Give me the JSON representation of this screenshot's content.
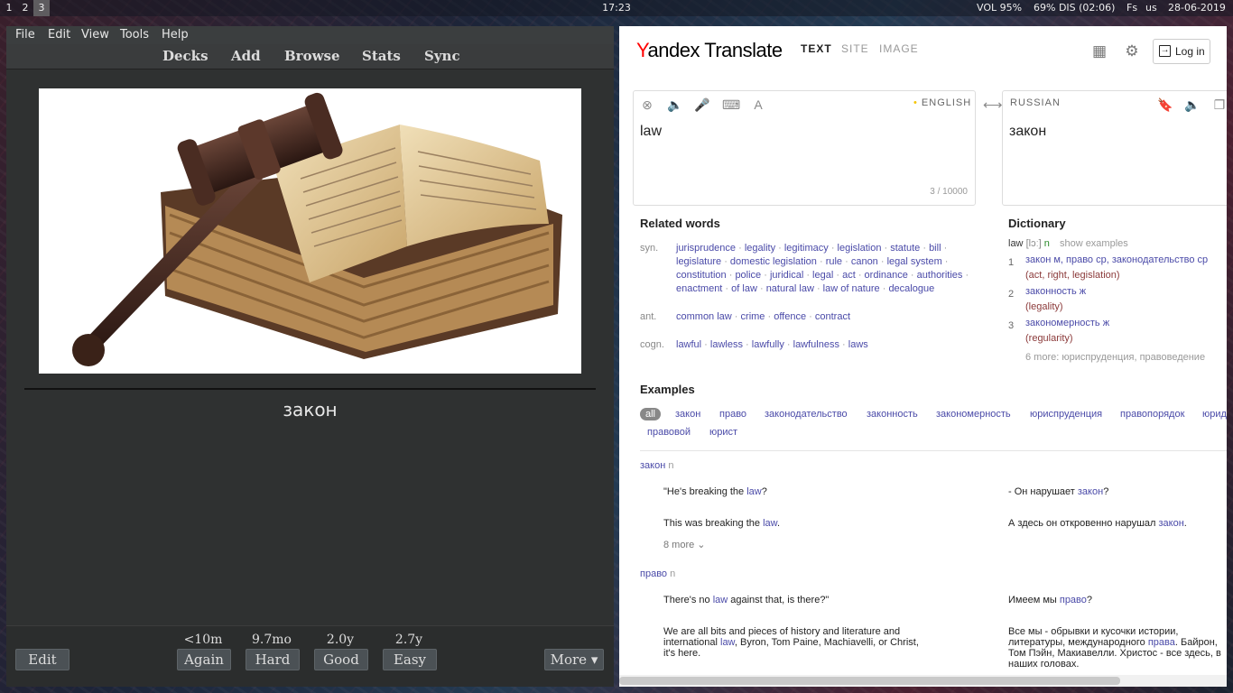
{
  "topbar": {
    "workspaces": [
      "1",
      "2",
      "3"
    ],
    "active_workspace": "3",
    "clock": "17:23",
    "volume": "VOL 95%",
    "battery": "69% DIS (02:06)",
    "layout1": "Fs",
    "layout2": "us",
    "date": "28-06-2019"
  },
  "anki": {
    "menu": [
      "File",
      "Edit",
      "View",
      "Tools",
      "Help"
    ],
    "toolbar": [
      "Decks",
      "Add",
      "Browse",
      "Stats",
      "Sync"
    ],
    "answer": "закон",
    "edit_label": "Edit",
    "more_label": "More ▾",
    "buttons": [
      {
        "interval": "<10m",
        "label": "Again"
      },
      {
        "interval": "9.7mo",
        "label": "Hard"
      },
      {
        "interval": "2.0y",
        "label": "Good"
      },
      {
        "interval": "2.7y",
        "label": "Easy"
      }
    ]
  },
  "yandex": {
    "logo_first": "Y",
    "logo_rest": "andex Translate",
    "tabs": [
      "TEXT",
      "SITE",
      "IMAGE"
    ],
    "login": "Log in",
    "source_lang": "ENGLISH",
    "target_lang": "RUSSIAN",
    "source_text": "law",
    "counter": "3 / 10000",
    "target_text": "закон",
    "related_title": "Related words",
    "syn_label": "syn.",
    "synonyms": [
      "jurisprudence",
      "legality",
      "legitimacy",
      "legislation",
      "statute",
      "bill",
      "legislature",
      "domestic legislation",
      "rule",
      "canon",
      "legal system",
      "constitution",
      "police",
      "juridical",
      "legal",
      "act",
      "ordinance",
      "authorities",
      "enactment",
      "of law",
      "natural law",
      "law of nature",
      "decalogue"
    ],
    "ant_label": "ant.",
    "antonyms": [
      "common law",
      "crime",
      "offence",
      "contract"
    ],
    "cogn_label": "cogn.",
    "cognates": [
      "lawful",
      "lawless",
      "lawfully",
      "lawfulness",
      "laws"
    ],
    "dict_title": "Dictionary",
    "dict_word": "law",
    "dict_pron": "[lɔː]",
    "dict_pos": "n",
    "show_examples": "show examples",
    "dict_entries": [
      {
        "num": "1",
        "line1": "закон м, право ср, законодательство ср",
        "line2": "(act, right, legislation)"
      },
      {
        "num": "2",
        "line1": "законность ж",
        "line2": "(legality)"
      },
      {
        "num": "3",
        "line1": "закономерность ж",
        "line2": "(regularity)"
      }
    ],
    "dict_more": "6 more: юриспруденция, правоведение",
    "examples_title": "Examples",
    "example_tabs": [
      "all",
      "закон",
      "право",
      "законодательство",
      "законность",
      "закономерность",
      "юриспруденция",
      "правопорядок",
      "юрид",
      "правовой",
      "юрист"
    ],
    "group1_word": "закон",
    "group1_pos": "n",
    "ex1_en_pre": "\"He's breaking the ",
    "ex1_en_hl": "law",
    "ex1_en_post": "?",
    "ex1_ru_pre": "- Он нарушает ",
    "ex1_ru_hl": "закон",
    "ex1_ru_post": "?",
    "ex2_en_pre": "This was breaking the ",
    "ex2_en_hl": "law",
    "ex2_en_post": ".",
    "ex2_ru_pre": "А здесь он откровенно нарушал ",
    "ex2_ru_hl": "закон",
    "ex2_ru_post": ".",
    "group1_more": "8 more ⌄",
    "group2_word": "право",
    "group2_pos": "n",
    "ex3_en_pre": "There's no ",
    "ex3_en_hl": "law",
    "ex3_en_post": " against that, is there?\"",
    "ex3_ru_pre": "Имеем мы ",
    "ex3_ru_hl": "право",
    "ex3_ru_post": "?",
    "ex4_en_pre": "We are all bits and pieces of history and literature and international ",
    "ex4_en_hl": "law",
    "ex4_en_post": ", Byron, Tom Paine, Machiavelli, or Christ, it's here.",
    "ex4_ru_pre": "Все мы - обрывки и кусочки истории, литературы, международного ",
    "ex4_ru_hl": "права",
    "ex4_ru_post": ". Байрон, Том Пэйн, Макиавелли. Христос - все здесь, в наших головах."
  }
}
